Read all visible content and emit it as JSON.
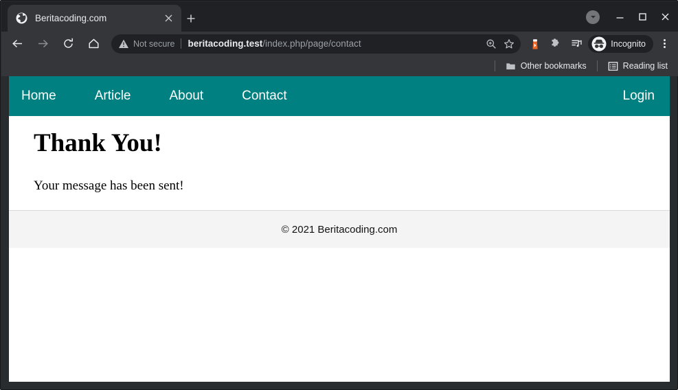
{
  "browser": {
    "tab": {
      "title": "Beritacoding.com",
      "favicon_icon": "globe-icon",
      "close_icon": "close-icon"
    },
    "new_tab_icon": "plus-icon",
    "window_controls": {
      "profile_icon": "caret-down-circle-icon",
      "minimize_icon": "minimize-icon",
      "maximize_icon": "maximize-icon",
      "close_icon": "close-icon"
    },
    "toolbar": {
      "back_icon": "arrow-left-icon",
      "forward_icon": "arrow-right-icon",
      "reload_icon": "reload-icon",
      "home_icon": "home-icon",
      "security_icon": "warning-triangle-icon",
      "security_label": "Not secure",
      "url_host": "beritacoding.test",
      "url_path": "/index.php/page/contact",
      "zoom_icon": "zoom-in-icon",
      "bookmark_icon": "star-icon",
      "lighthouse_icon": "lighthouse-icon",
      "extensions_icon": "puzzle-piece-icon",
      "media_list_icon": "playlist-icon",
      "incognito_icon": "incognito-icon",
      "incognito_label": "Incognito",
      "menu_icon": "three-dots-vertical-icon"
    },
    "bookmarks_bar": {
      "other_bookmarks_icon": "folder-icon",
      "other_bookmarks_label": "Other bookmarks",
      "reading_list_icon": "reading-list-icon",
      "reading_list_label": "Reading list"
    }
  },
  "page": {
    "nav": {
      "background_color": "#008080",
      "links": [
        {
          "label": "Home"
        },
        {
          "label": "Article"
        },
        {
          "label": "About"
        },
        {
          "label": "Contact"
        }
      ],
      "login_label": "Login"
    },
    "heading": "Thank You!",
    "message": "Your message has been sent!",
    "footer": "© 2021 Beritacoding.com"
  }
}
